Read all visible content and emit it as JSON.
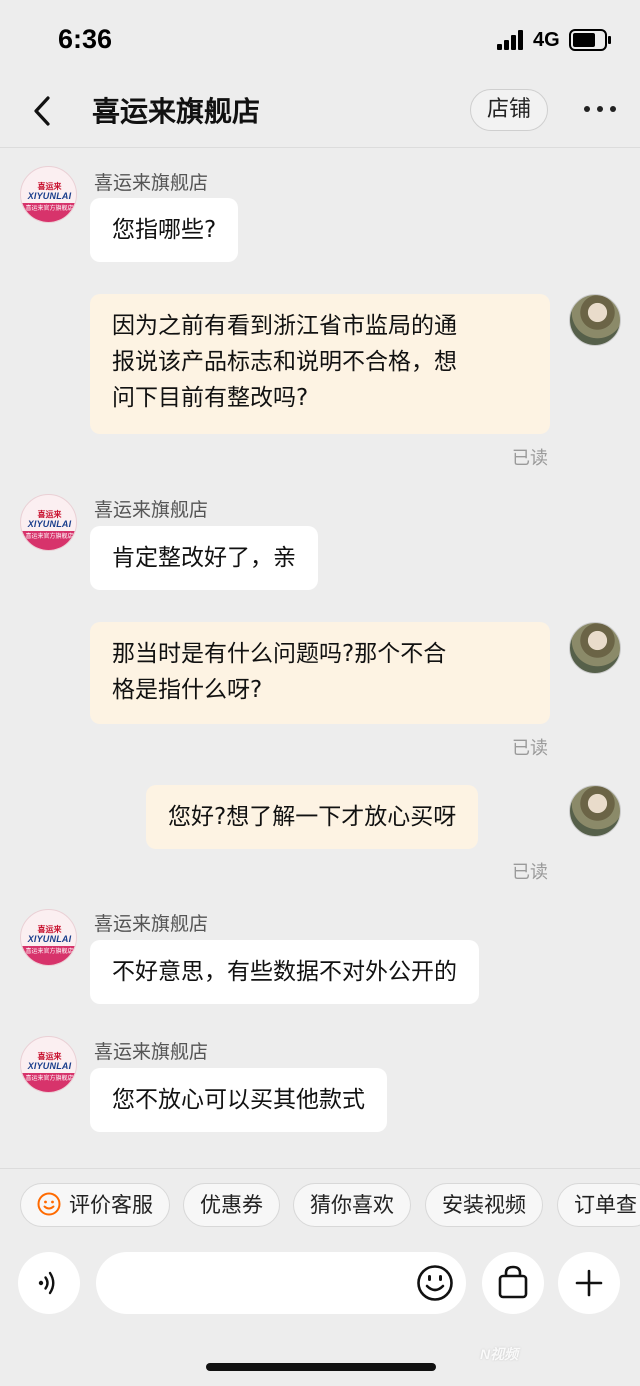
{
  "status_bar": {
    "time": "6:36",
    "network": "4G"
  },
  "header": {
    "title": "喜运来旗舰店",
    "store_button": "店铺",
    "back_icon": "chevron-left-icon",
    "more_icon": "more-horizontal-icon"
  },
  "shop_avatar": {
    "logo_top": "喜运来",
    "logo_main": "XIYUNLAI",
    "logo_band": "喜运来官方旗舰店"
  },
  "messages": [
    {
      "sender": "shop",
      "name": "喜运来旗舰店",
      "text": "您指哪些?"
    },
    {
      "sender": "user",
      "lines": [
        "因为之前有看到浙江省市监局的通",
        "报说该产品标志和说明不合格，想",
        "问下目前有整改吗?"
      ],
      "status": "已读"
    },
    {
      "sender": "shop",
      "name": "喜运来旗舰店",
      "text": "肯定整改好了，亲"
    },
    {
      "sender": "user",
      "lines": [
        "那当时是有什么问题吗?那个不合",
        "格是指什么呀?"
      ],
      "status": "已读"
    },
    {
      "sender": "user",
      "text": "您好?想了解一下才放心买呀",
      "status": "已读"
    },
    {
      "sender": "shop",
      "name": "喜运来旗舰店",
      "text": "不好意思，有些数据不对外公开的"
    },
    {
      "sender": "shop",
      "name": "喜运来旗舰店",
      "text": "您不放心可以买其他款式"
    }
  ],
  "quick_replies": [
    "评价客服",
    "优惠券",
    "猜你喜欢",
    "安装视频",
    "订单查"
  ],
  "input_bar": {
    "placeholder": "",
    "voice_icon": "voice-icon",
    "emoji_icon": "emoji-icon",
    "bag_icon": "shopping-bag-icon",
    "plus_icon": "plus-icon"
  },
  "watermark": "N视频",
  "colors": {
    "background": "#ededed",
    "user_bubble": "#fdf3e3",
    "shop_bubble": "#ffffff",
    "brand_red": "#c8102e",
    "brand_pink": "#d7336b"
  }
}
